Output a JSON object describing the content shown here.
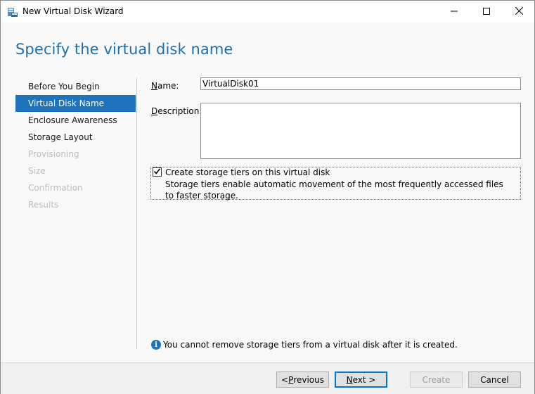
{
  "window": {
    "title": "New Virtual Disk Wizard"
  },
  "page": {
    "heading": "Specify the virtual disk name"
  },
  "nav": {
    "items": [
      {
        "label": "Before You Begin",
        "state": "normal"
      },
      {
        "label": "Virtual Disk Name",
        "state": "active"
      },
      {
        "label": "Enclosure Awareness",
        "state": "normal"
      },
      {
        "label": "Storage Layout",
        "state": "normal"
      },
      {
        "label": "Provisioning",
        "state": "disabled"
      },
      {
        "label": "Size",
        "state": "disabled"
      },
      {
        "label": "Confirmation",
        "state": "disabled"
      },
      {
        "label": "Results",
        "state": "disabled"
      }
    ]
  },
  "form": {
    "name_label_pre": "N",
    "name_label_post": "ame:",
    "name_value": "VirtualDisk01",
    "description_label_pre": "D",
    "description_label_post": "escription:",
    "description_value": "",
    "tiers_checked": true,
    "tiers_label": "Create storage tiers on this virtual disk",
    "tiers_description": "Storage tiers enable automatic movement of the most frequently accessed files to faster storage."
  },
  "info": {
    "text": "You cannot remove storage tiers from a virtual disk after it is created."
  },
  "buttons": {
    "previous_pre": "< ",
    "previous_key": "P",
    "previous_post": "revious",
    "next_key": "N",
    "next_post": "ext >",
    "create": "Create",
    "cancel": "Cancel"
  },
  "colors": {
    "accent": "#1f73bd",
    "heading": "#1e6fb2",
    "disabled_text": "#bdbdbd"
  }
}
